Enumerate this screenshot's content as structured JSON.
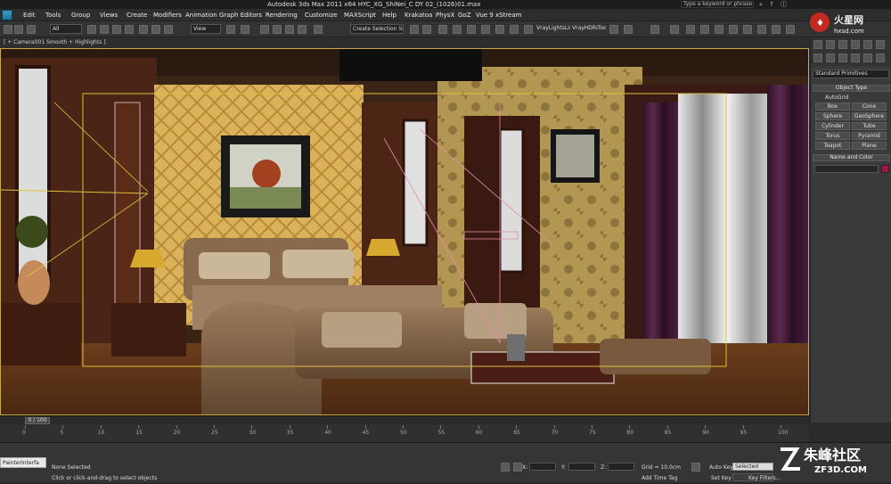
{
  "window": {
    "title": "Autodesk 3ds Max  2011 x64       HYC_XG_ShiNei_C DY 02_(1026)01.max",
    "search_placeholder": "Type a keyword or phrase"
  },
  "menu": [
    "Edit",
    "Tools",
    "Group",
    "Views",
    "Create",
    "Modifiers",
    "Animation",
    "Graph Editors",
    "Rendering",
    "Customize",
    "MAXScript",
    "Help",
    "Krakatoa",
    "PhysX",
    "GoZ",
    "Vue 9 xStream"
  ],
  "toolbar": {
    "selection_filter": "All",
    "reference_coord": "View",
    "named_selection": "Create Selection Se",
    "plugin_label_1": "VrayLightsListe",
    "plugin_label_2": "VrayHDRITool"
  },
  "viewport": {
    "label": "[ + Camera001 Smooth + Highlights ]"
  },
  "command_panel": {
    "category": "Standard Primitives",
    "object_type_title": "Object Type",
    "autogrid_label": "AutoGrid",
    "buttons": [
      "Box",
      "Cone",
      "Sphere",
      "GeoSphere",
      "Cylinder",
      "Tube",
      "Torus",
      "Pyramid",
      "Teapot",
      "Plane"
    ],
    "name_color_title": "Name and Color",
    "color": "#9b1a4d"
  },
  "timeline": {
    "slider": "0 / 100",
    "ticks": [
      "0",
      "5",
      "10",
      "15",
      "20",
      "25",
      "30",
      "35",
      "40",
      "45",
      "50",
      "55",
      "60",
      "65",
      "70",
      "75",
      "80",
      "85",
      "90",
      "95",
      "100"
    ]
  },
  "status": {
    "maxscript_listener": "PainterInterfa",
    "selection": "None Selected",
    "prompt": "Click or click-and-drag to select objects",
    "x_label": "X:",
    "y_label": "Y:",
    "z_label": "Z:",
    "grid": "Grid = 10.0cm",
    "add_time_tag": "Add Time Tag",
    "auto_key": "Auto Key",
    "set_key": "Set Key",
    "key_mode": "Selected",
    "key_filters": "Key Filters..."
  },
  "watermarks": {
    "top_brand": "火星网",
    "top_url": "hxsd.com",
    "bottom_brand": "朱峰社区",
    "bottom_url": "ZF3D.COM"
  }
}
